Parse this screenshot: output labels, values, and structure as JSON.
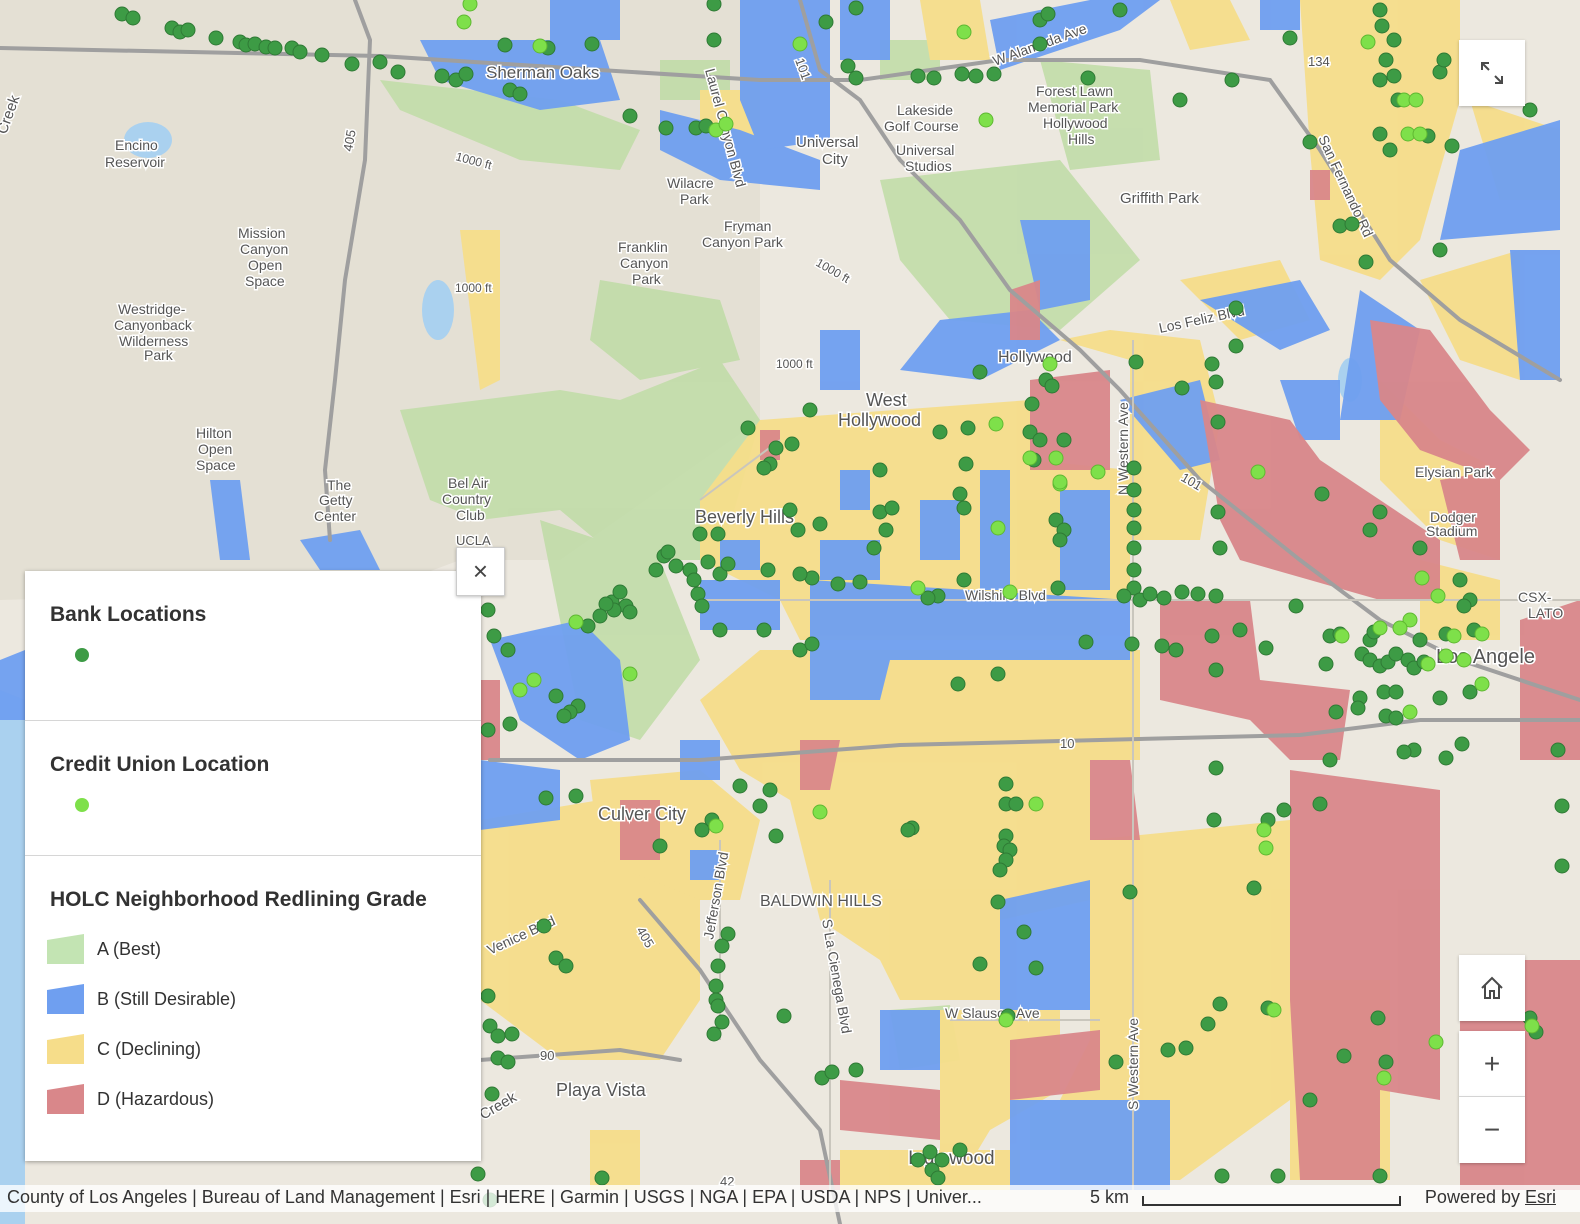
{
  "map": {
    "place_labels": [
      {
        "name": "sherman-oaks-label",
        "text": "Sherman Oaks"
      },
      {
        "name": "encino-reservoir-label-1",
        "text": "Encino"
      },
      {
        "name": "encino-reservoir-label-2",
        "text": "Reservoir"
      },
      {
        "name": "lakeside-golf-label-1",
        "text": "Lakeside"
      },
      {
        "name": "lakeside-golf-label-2",
        "text": "Golf Course"
      },
      {
        "name": "forest-lawn-label-1",
        "text": "Forest Lawn"
      },
      {
        "name": "forest-lawn-label-2",
        "text": "Memorial Park"
      },
      {
        "name": "forest-lawn-label-3",
        "text": "Hollywood"
      },
      {
        "name": "forest-lawn-label-4",
        "text": "Hills"
      },
      {
        "name": "universal-city-label-1",
        "text": "Universal"
      },
      {
        "name": "universal-city-label-2",
        "text": "City"
      },
      {
        "name": "universal-studios-label-1",
        "text": "Universal"
      },
      {
        "name": "universal-studios-label-2",
        "text": "Studios"
      },
      {
        "name": "griffith-park-label",
        "text": "Griffith Park"
      },
      {
        "name": "wilacre-park-label-1",
        "text": "Wilacre"
      },
      {
        "name": "wilacre-park-label-2",
        "text": "Park"
      },
      {
        "name": "fryman-canyon-label-1",
        "text": "Fryman"
      },
      {
        "name": "fryman-canyon-label-2",
        "text": "Canyon Park"
      },
      {
        "name": "franklin-canyon-label-1",
        "text": "Franklin"
      },
      {
        "name": "franklin-canyon-label-2",
        "text": "Canyon"
      },
      {
        "name": "franklin-canyon-label-3",
        "text": "Park"
      },
      {
        "name": "mission-canyon-label-1",
        "text": "Mission"
      },
      {
        "name": "mission-canyon-label-2",
        "text": "Canyon"
      },
      {
        "name": "mission-canyon-label-3",
        "text": "Open"
      },
      {
        "name": "mission-canyon-label-4",
        "text": "Space"
      },
      {
        "name": "westridge-label-1",
        "text": "Westridge-"
      },
      {
        "name": "westridge-label-2",
        "text": "Canyonback"
      },
      {
        "name": "westridge-label-3",
        "text": "Wilderness"
      },
      {
        "name": "westridge-label-4",
        "text": "Park"
      },
      {
        "name": "hilton-open-space-label-1",
        "text": "Hilton"
      },
      {
        "name": "hilton-open-space-label-2",
        "text": "Open"
      },
      {
        "name": "hilton-open-space-label-3",
        "text": "Space"
      },
      {
        "name": "getty-center-label-1",
        "text": "The"
      },
      {
        "name": "getty-center-label-2",
        "text": "Getty"
      },
      {
        "name": "getty-center-label-3",
        "text": "Center"
      },
      {
        "name": "bel-air-label-1",
        "text": "Bel Air"
      },
      {
        "name": "bel-air-label-2",
        "text": "Country"
      },
      {
        "name": "bel-air-label-3",
        "text": "Club"
      },
      {
        "name": "ucla-label",
        "text": "UCLA"
      },
      {
        "name": "hollywood-label",
        "text": "Hollywood"
      },
      {
        "name": "west-hollywood-label-1",
        "text": "West"
      },
      {
        "name": "west-hollywood-label-2",
        "text": "Hollywood"
      },
      {
        "name": "beverly-hills-label",
        "text": "Beverly Hills"
      },
      {
        "name": "elysian-park-label",
        "text": "Elysian Park"
      },
      {
        "name": "dodger-stadium-label-1",
        "text": "Dodger"
      },
      {
        "name": "dodger-stadium-label-2",
        "text": "Stadium"
      },
      {
        "name": "los-angeles-label",
        "text": "Los Angele"
      },
      {
        "name": "culver-city-label",
        "text": "Culver City"
      },
      {
        "name": "baldwin-hills-label",
        "text": "BALDWIN HILLS"
      },
      {
        "name": "playa-vista-label",
        "text": "Playa Vista"
      },
      {
        "name": "inglewood-label",
        "text": "Inglewood"
      },
      {
        "name": "csx-label-1",
        "text": "CSX-"
      },
      {
        "name": "csx-label-2",
        "text": "LATO"
      },
      {
        "name": "creek-label-1",
        "text": "Creek"
      },
      {
        "name": "creek-label-2",
        "text": "Creek"
      },
      {
        "name": "wilshire-label",
        "text": "Wilshire Blvd"
      },
      {
        "name": "los-feliz-label",
        "text": "Los Feliz Blvd"
      },
      {
        "name": "laurel-canyon-label",
        "text": "Laurel Canyon Blvd"
      },
      {
        "name": "alameda-label",
        "text": "W Alameda Ave"
      },
      {
        "name": "san-fernando-label",
        "text": "San Fernando Rd"
      },
      {
        "name": "n-western-label",
        "text": "N Western Ave"
      },
      {
        "name": "s-western-label",
        "text": "S Western Ave"
      },
      {
        "name": "la-cienega-label",
        "text": "S La Cienega Blvd"
      },
      {
        "name": "w-slauson-label",
        "text": "W Slauson Ave"
      },
      {
        "name": "venice-label",
        "text": "Venice Blvd"
      },
      {
        "name": "jefferson-label",
        "text": "Jefferson Blvd"
      },
      {
        "name": "elev-label-1",
        "text": "1000 ft"
      },
      {
        "name": "elev-label-2",
        "text": "1000 ft"
      },
      {
        "name": "elev-label-3",
        "text": "1000 ft"
      },
      {
        "name": "elev-label-4",
        "text": "1000 ft"
      },
      {
        "name": "hwy-405-label-1",
        "text": "405"
      },
      {
        "name": "hwy-405-label-2",
        "text": "405"
      },
      {
        "name": "hwy-101-label-1",
        "text": "101"
      },
      {
        "name": "hwy-101-label-2",
        "text": "101"
      },
      {
        "name": "hwy-134-label",
        "text": "134"
      },
      {
        "name": "hwy-10-label",
        "text": "10"
      },
      {
        "name": "hwy-90-label",
        "text": "90"
      },
      {
        "name": "hwy-42-label",
        "text": "42"
      }
    ]
  },
  "legend": {
    "close_symbol": "×",
    "bank": {
      "title": "Bank Locations",
      "color": "#3d9b45"
    },
    "credit_union": {
      "title": "Credit Union Location",
      "color": "#7ee04a"
    },
    "holc": {
      "title": "HOLC Neighborhood Redlining Grade",
      "grades": [
        {
          "label": "A (Best)",
          "color": "#c3e4b3"
        },
        {
          "label": "B (Still Desirable)",
          "color": "#6f9ff0"
        },
        {
          "label": "C (Declining)",
          "color": "#f6dd8a"
        },
        {
          "label": "D (Hazardous)",
          "color": "#d9878a"
        }
      ]
    }
  },
  "controls": {
    "fullscreen_icon": "expand-icon",
    "home_icon": "home-icon",
    "zoom_in": "+",
    "zoom_out": "−"
  },
  "attribution": {
    "text": "County of Los Angeles | Bureau of Land Management | Esri | HERE | Garmin | USGS | NGA | EPA | USDA | NPS | Univer...",
    "scale": "5 km",
    "powered_by": "Powered by",
    "esri": "Esri"
  }
}
